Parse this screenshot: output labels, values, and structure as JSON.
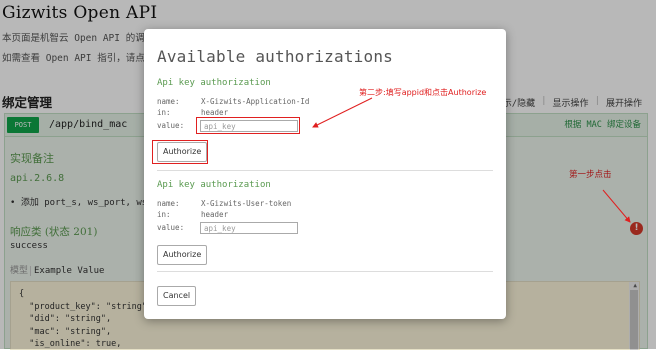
{
  "page": {
    "title": "Gizwits Open API",
    "intro_line1": "本页面是机智云 Open API 的调",
    "intro_line2": "如需查看 Open API 指引，请点",
    "section_title": "绑定管理",
    "right_links": [
      "显示/隐藏",
      "显示操作",
      "展开操作"
    ]
  },
  "operation": {
    "method": "POST",
    "path": "/app/bind_mac",
    "summary": "根据 MAC 绑定设备",
    "notes_title": "实现备注",
    "version": "api.2.6.8",
    "bullet": "• 添加 port_s, ws_port, wss",
    "response_title": "响应类 (状态 201)",
    "response_text": "success",
    "tab_model": "模型",
    "tab_example": "Example Value",
    "code_lines": [
      "{",
      "  \"product_key\": \"string\",",
      "  \"did\": \"string\",",
      "  \"mac\": \"string\",",
      "  \"is_online\": true,"
    ]
  },
  "modal": {
    "title": "Available authorizations",
    "auth1": {
      "heading": "Api key authorization",
      "name_label": "name:",
      "name_value": "X-Gizwits-Application-Id",
      "in_label": "in:",
      "in_value": "header",
      "value_label": "value:",
      "value_placeholder": "api_key",
      "button": "Authorize"
    },
    "auth2": {
      "heading": "Api key authorization",
      "name_label": "name:",
      "name_value": "X-Gizwits-User-token",
      "in_label": "in:",
      "in_value": "header",
      "value_label": "value:",
      "value_placeholder": "api_key",
      "button": "Authorize"
    },
    "cancel": "Cancel"
  },
  "annotations": {
    "step1": "第一步点击",
    "step2": "第二步:填写appid和点击Authorize"
  },
  "colors": {
    "method_badge": "#10a54a",
    "accent_green": "#5a9a50",
    "annotation_red": "#e02020",
    "error_icon": "#d63a2a"
  },
  "icons": {
    "error": "exclamation-circle-icon",
    "scroll_up": "triangle-up-icon"
  }
}
